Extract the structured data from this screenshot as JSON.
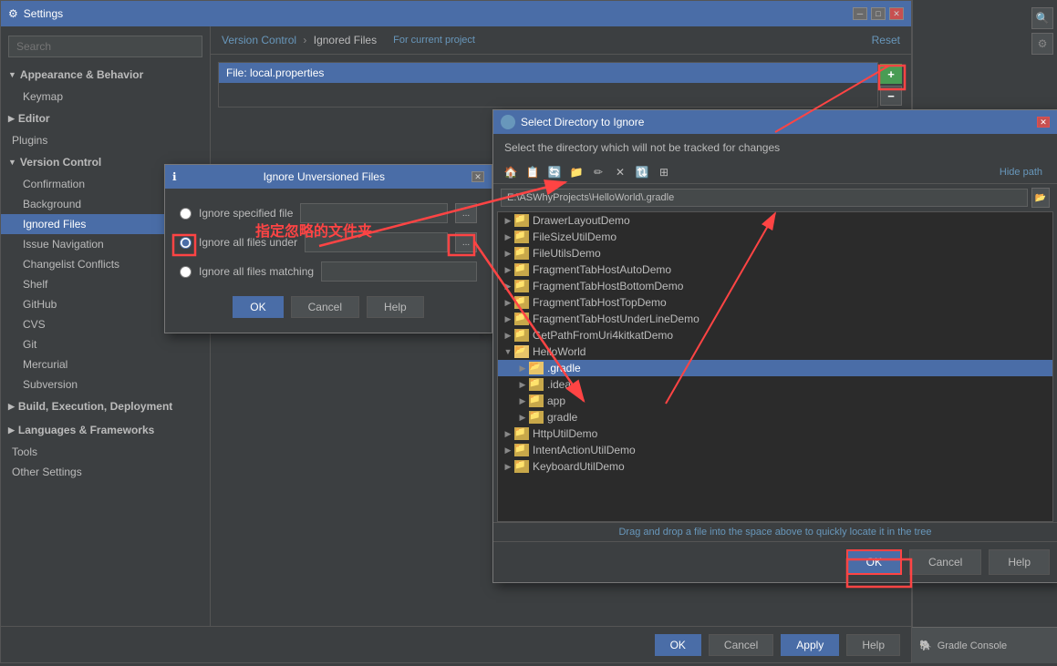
{
  "window": {
    "title": "Settings",
    "titleIcon": "⚙"
  },
  "sidebar": {
    "search_placeholder": "Search",
    "items": [
      {
        "id": "appearance-behavior",
        "label": "Appearance & Behavior",
        "level": 0,
        "expanded": true,
        "type": "header"
      },
      {
        "id": "keymap",
        "label": "Keymap",
        "level": 1,
        "type": "item"
      },
      {
        "id": "editor",
        "label": "Editor",
        "level": 0,
        "type": "header"
      },
      {
        "id": "plugins",
        "label": "Plugins",
        "level": 0,
        "type": "item"
      },
      {
        "id": "version-control",
        "label": "Version Control",
        "level": 0,
        "expanded": true,
        "type": "header"
      },
      {
        "id": "confirmation",
        "label": "Confirmation",
        "level": 1,
        "type": "item"
      },
      {
        "id": "background",
        "label": "Background",
        "level": 1,
        "type": "item"
      },
      {
        "id": "ignored-files",
        "label": "Ignored Files",
        "level": 1,
        "type": "item",
        "selected": true
      },
      {
        "id": "issue-navigation",
        "label": "Issue Navigation",
        "level": 1,
        "type": "item"
      },
      {
        "id": "changelist-conflicts",
        "label": "Changelist Conflicts",
        "level": 1,
        "type": "item"
      },
      {
        "id": "shelf",
        "label": "Shelf",
        "level": 1,
        "type": "item"
      },
      {
        "id": "github",
        "label": "GitHub",
        "level": 1,
        "type": "item"
      },
      {
        "id": "cvs",
        "label": "CVS",
        "level": 1,
        "type": "item"
      },
      {
        "id": "git",
        "label": "Git",
        "level": 1,
        "type": "item"
      },
      {
        "id": "mercurial",
        "label": "Mercurial",
        "level": 1,
        "type": "item"
      },
      {
        "id": "subversion",
        "label": "Subversion",
        "level": 1,
        "type": "item"
      },
      {
        "id": "build-execution",
        "label": "Build, Execution, Deployment",
        "level": 0,
        "type": "header"
      },
      {
        "id": "languages-frameworks",
        "label": "Languages & Frameworks",
        "level": 0,
        "type": "header"
      },
      {
        "id": "tools",
        "label": "Tools",
        "level": 0,
        "type": "item"
      },
      {
        "id": "other-settings",
        "label": "Other Settings",
        "level": 0,
        "type": "item"
      }
    ]
  },
  "breadcrumb": {
    "path": "Version Control",
    "separator": "›",
    "current": "Ignored Files",
    "project_text": "For current project"
  },
  "reset_label": "Reset",
  "ignored_files": {
    "entry": "File: local.properties"
  },
  "bottom_buttons": {
    "ok": "OK",
    "cancel": "Cancel",
    "apply": "Apply",
    "help": "Help"
  },
  "ignore_dialog": {
    "title": "Ignore Unversioned Files",
    "option1": "Ignore specified file",
    "option2": "Ignore all files under",
    "option3": "Ignore all files matching",
    "ok_label": "OK",
    "cancel_label": "Cancel",
    "help_label": "Help",
    "chinese_text": "指定忽略的文件夹"
  },
  "select_dir_dialog": {
    "title": "Select Directory to Ignore",
    "subtitle": "Select the directory which will not be tracked for changes",
    "path": "E:\\ASWhyProjects\\HelloWorld\\.gradle",
    "hide_path": "Hide path",
    "tree_items": [
      {
        "id": "drawer",
        "label": "DrawerLayoutDemo",
        "level": 1,
        "icon": "folder"
      },
      {
        "id": "filesize",
        "label": "FileSizeUtilDemo",
        "level": 1,
        "icon": "folder"
      },
      {
        "id": "fileutils",
        "label": "FileUtilsDemo",
        "level": 1,
        "icon": "folder"
      },
      {
        "id": "fragmenttab1",
        "label": "FragmentTabHostAutoDemo",
        "level": 1,
        "icon": "folder"
      },
      {
        "id": "fragmenttab2",
        "label": "FragmentTabHostBottomDemo",
        "level": 1,
        "icon": "folder"
      },
      {
        "id": "fragmenttab3",
        "label": "FragmentTabHostTopDemo",
        "level": 1,
        "icon": "folder"
      },
      {
        "id": "fragmenttab4",
        "label": "FragmentTabHostUnderLineDemo",
        "level": 1,
        "icon": "folder"
      },
      {
        "id": "getpath",
        "label": "GetPathFromUri4kitkatDemo",
        "level": 1,
        "icon": "folder"
      },
      {
        "id": "helloworld",
        "label": "HelloWorld",
        "level": 1,
        "icon": "folder",
        "expanded": true
      },
      {
        "id": "gradle",
        "label": ".gradle",
        "level": 2,
        "icon": "folder",
        "selected": true,
        "expanded": true
      },
      {
        "id": "idea",
        "label": ".idea",
        "level": 2,
        "icon": "folder"
      },
      {
        "id": "app",
        "label": "app",
        "level": 2,
        "icon": "folder"
      },
      {
        "id": "gradle2",
        "label": "gradle",
        "level": 2,
        "icon": "folder"
      },
      {
        "id": "httputil",
        "label": "HttpUtilDemo",
        "level": 1,
        "icon": "folder"
      },
      {
        "id": "intentaction",
        "label": "IntentActionUtilDemo",
        "level": 1,
        "icon": "folder"
      },
      {
        "id": "keyboardutil",
        "label": "KeyboardUtilDemo",
        "level": 1,
        "icon": "folder"
      }
    ],
    "status_text": "Drag and drop a file into the space above to quickly locate it in the tree",
    "ok_label": "OK",
    "cancel_label": "Cancel",
    "help_label": "Help"
  },
  "toolbar_icons": [
    "🏠",
    "📋",
    "🔄",
    "📁",
    "✏",
    "❌",
    "🔃",
    "⊞"
  ],
  "colors": {
    "accent": "#4a6da7",
    "bg": "#3c3f41",
    "selected": "#4a6da7",
    "text": "#bbbbbb",
    "red": "#ff4444"
  }
}
